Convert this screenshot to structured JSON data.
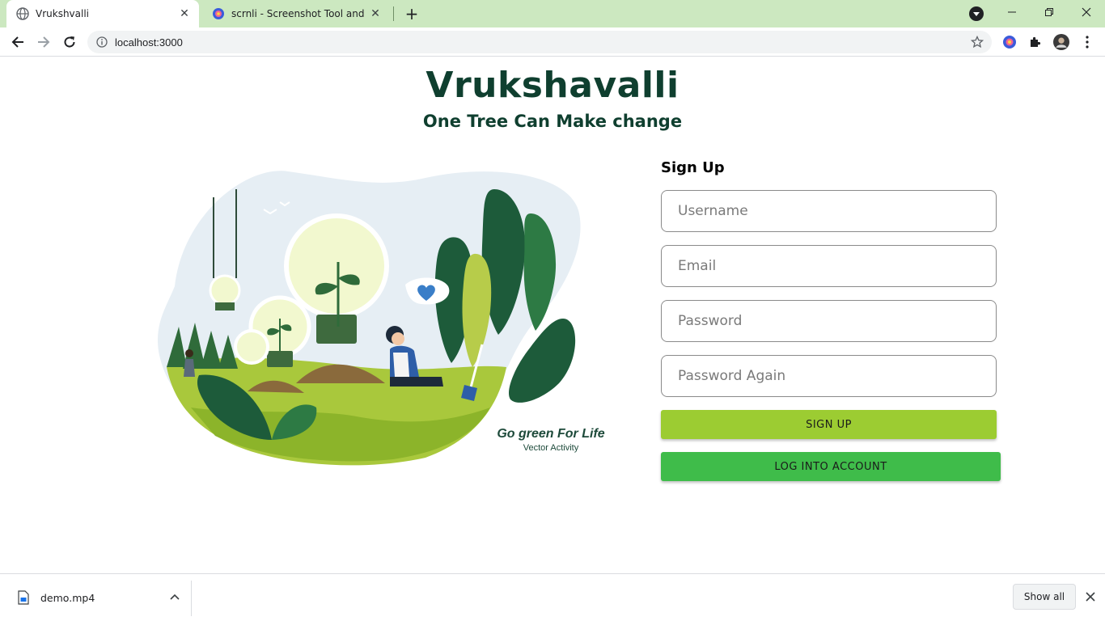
{
  "browser": {
    "tabs": [
      {
        "title": "Vrukshvalli",
        "active": true,
        "icon": "globe-icon"
      },
      {
        "title": "scrnli - Screenshot Tool and Editor",
        "active": false,
        "icon": "scrnli-icon"
      }
    ],
    "new_tab_icon": "plus-icon",
    "url": "localhost:3000",
    "theme_color": "#cce8c0"
  },
  "header": {
    "title": "Vrukshavalli",
    "subtitle": "One Tree Can Make change"
  },
  "illustration": {
    "caption_title": "Go green For Life",
    "caption_credit": "Vector Activity"
  },
  "signup": {
    "title": "Sign Up",
    "username_placeholder": "Username",
    "email_placeholder": "Email",
    "password_placeholder": "Password",
    "password_again_placeholder": "Password Again",
    "signup_button": "SIGN UP",
    "login_button": "LOG INTO ACCOUNT",
    "signup_color": "#9ccc32",
    "login_color": "#3fbc4a"
  },
  "downloads": {
    "file_name": "demo.mp4",
    "show_all": "Show all"
  }
}
